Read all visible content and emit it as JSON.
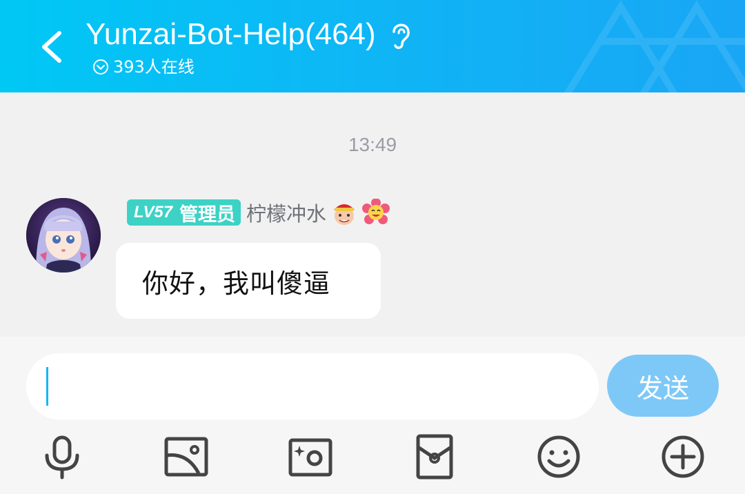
{
  "header": {
    "title": "Yunzai-Bot-Help(464)",
    "online_status": "393人在线",
    "back_icon": "chevron-left-icon",
    "ear_icon": "ear-icon"
  },
  "chat": {
    "timestamp": "13:49",
    "message": {
      "badge_level": "LV57",
      "badge_role": "管理员",
      "nickname": "柠檬冲水",
      "text": "你好，我叫傻逼"
    }
  },
  "input": {
    "value": "",
    "send_label": "发送"
  },
  "toolbar": {
    "items": [
      "microphone-icon",
      "image-icon",
      "camera-icon",
      "red-packet-icon",
      "emoji-icon",
      "plus-icon"
    ]
  },
  "colors": {
    "header": "#12b7f5",
    "badge": "#3cd2c6",
    "send_button": "#7ec8f7",
    "background": "#f1f1f1"
  }
}
